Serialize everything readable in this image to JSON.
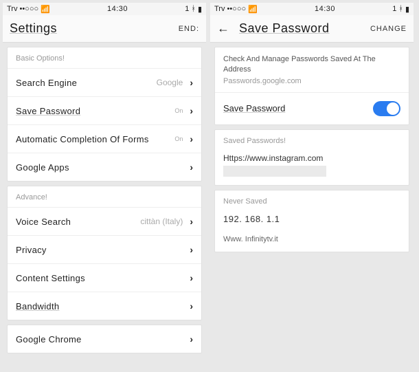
{
  "status": {
    "carrier": "Trv",
    "signal": "••○○○",
    "wifi": "⌃",
    "time": "14:30",
    "bt": "1",
    "battery": "■"
  },
  "left": {
    "title": "Settings",
    "end_label": "END:",
    "sections": {
      "basic": {
        "label": "Basic Options!",
        "rows": {
          "search": {
            "label": "Search Engine",
            "value": "Google"
          },
          "savepw": {
            "label": "Save Password",
            "value": "On"
          },
          "autofill": {
            "label": "Automatic Completion Of Forms",
            "value": "On"
          },
          "gapps": {
            "label": "Google Apps",
            "value": ""
          }
        }
      },
      "advance": {
        "label": "Advance!",
        "rows": {
          "voice": {
            "label": "Voice Search",
            "value": "cittàn (Italy)"
          },
          "privacy": {
            "label": "Privacy",
            "value": ""
          },
          "content": {
            "label": "Content Settings",
            "value": ""
          },
          "bandwidth": {
            "label": "Bandwidth",
            "value": ""
          }
        }
      },
      "chrome": {
        "rows": {
          "gchrome": {
            "label": "Google Chrome",
            "value": ""
          }
        }
      }
    }
  },
  "right": {
    "title": "Save Password",
    "change_label": "CHANGE",
    "desc": "Check And Manage Passwords Saved At The Address",
    "desc_link": "Passwords.google.com",
    "toggle_label": "Save Password",
    "toggle_on": true,
    "saved": {
      "label": "Saved Passwords!",
      "items": {
        "0": {
          "url": "Https://www.instagram.com"
        }
      }
    },
    "never": {
      "label": "Never Saved",
      "items": {
        "0": "192. 168. 1.1",
        "1": "Www. Infinitytv.it"
      }
    }
  }
}
